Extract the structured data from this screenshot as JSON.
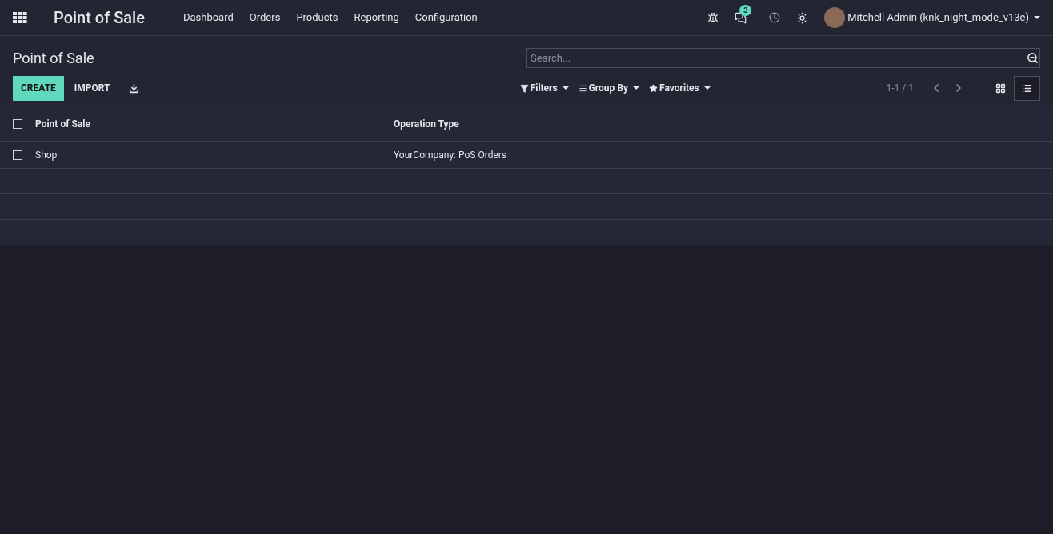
{
  "navbar": {
    "app_name": "Point of Sale",
    "menu": [
      "Dashboard",
      "Orders",
      "Products",
      "Reporting",
      "Configuration"
    ],
    "message_count": "3",
    "user": "Mitchell Admin (knk_night_mode_v13e)"
  },
  "control_panel": {
    "title": "Point of Sale",
    "search": {
      "placeholder": "Search..."
    },
    "buttons": [
      {
        "label": "CREATE",
        "kind": "primary"
      },
      {
        "label": "IMPORT",
        "kind": "plain"
      }
    ],
    "search_options": [
      {
        "label": "Filters",
        "kind": "filter"
      },
      {
        "label": "Group By",
        "kind": "group"
      },
      {
        "label": "Favorites",
        "kind": "favorite"
      }
    ],
    "pager": "1-1 / 1",
    "views": [
      {
        "kind": "kanban",
        "selected": false
      },
      {
        "kind": "list",
        "selected": true
      }
    ]
  },
  "table": {
    "select_all_checked": false,
    "columns": [
      "Point of Sale",
      "Operation Type"
    ],
    "rows": [
      {
        "checked": false,
        "cells": [
          "Shop",
          "YourCompany: PoS Orders"
        ]
      }
    ]
  }
}
